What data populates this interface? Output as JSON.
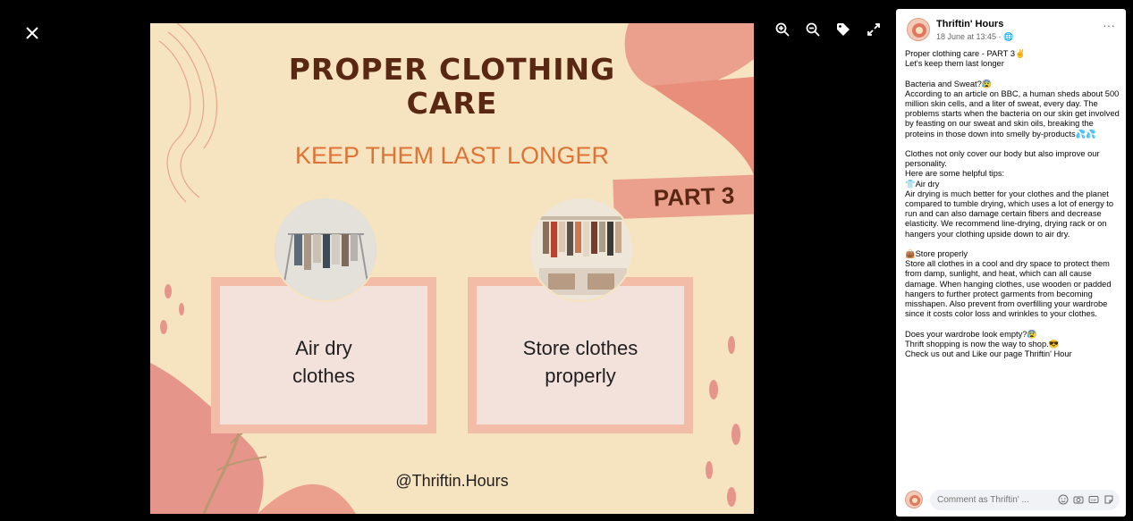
{
  "viewer": {
    "close_icon": "close-icon"
  },
  "toolbar": {
    "icons": [
      "zoom-in-icon",
      "zoom-out-icon",
      "tag-icon",
      "fullscreen-icon"
    ]
  },
  "photo": {
    "title_line1": "PROPER CLOTHING",
    "title_line2": "CARE",
    "subtitle": "KEEP THEM LAST LONGER",
    "part": "PART 3",
    "card1_line1": "Air dry",
    "card1_line2": "clothes",
    "card2_line1": "Store clothes",
    "card2_line2": "properly",
    "handle": "@Thriftin.Hours",
    "colors": {
      "background": "#f6e3c0",
      "title": "#5a2812",
      "subtitle": "#dd7436",
      "accent": "#eba08d"
    }
  },
  "post": {
    "page_name": "Thriftin' Hours",
    "meta": "18 June at 13:45 · ",
    "more_label": "···",
    "body": "Proper clothing care - PART 3✌\nLet's keep them last longer\n\nBacteria and Sweat?😰\nAccording to an article on BBC, a human sheds about 500 million skin cells, and a liter of sweat, every day. The problems starts when the bacteria on our skin get involved by feasting on our sweat and skin oils, breaking the proteins in those down into smelly by-products💦💦\n\nClothes not only cover our body but also improve our personality.\nHere are some helpful tips:\n👕Air dry\nAir drying is much better for your clothes and the planet compared to tumble drying, which uses a lot of energy to run and can also damage certain fibers and decrease elasticity. We recommend line-drying, drying rack or on hangers your clothing upside down to air dry.\n\n👜Store properly\nStore all clothes in a cool and dry space to protect them from damp, sunlight, and heat, which can all cause damage. When hanging clothes, use wooden or padded hangers to further protect garments from becoming misshapen. Also prevent from overfilling your wardrobe since it costs color loss and wrinkles to your clothes.\n\nDoes your wardrobe look empty?😰\nThrift shopping is now the way to shop.😎\nCheck us out and Like our page Thriftin' Hour",
    "comment_placeholder": "Comment as Thriftin' ..."
  }
}
